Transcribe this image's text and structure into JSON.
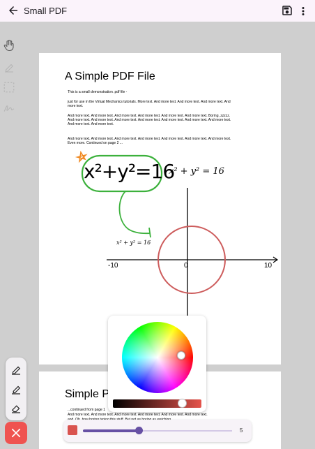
{
  "appbar": {
    "title": "Small PDF"
  },
  "colors": {
    "ink_green": "#3cb13c",
    "ink_orange": "#f08a24",
    "circle_red": "#cd5c5c",
    "accent": "#6750a4",
    "close": "#ef5350",
    "selected_color": "#d9534f"
  },
  "icons": {
    "back": "back-arrow-icon",
    "save": "save-icon",
    "more": "more-vert-icon",
    "hand": "hand-icon",
    "pen": "pen-icon",
    "select": "select-icon",
    "signature": "signature-icon",
    "eraser": "eraser-icon",
    "close": "close-icon"
  },
  "page1": {
    "title": "A Simple PDF File",
    "p1": "This is a small demonstration .pdf file -",
    "p2": "just for use in the Virtual Mechanics tutorials. More text. And more text. And more text. And more text. And more text.",
    "p3": "And more text. And more text. And more text. And more text. And more text. And more text. Boring, zzzzz. And more text. And more text. And more text. And more text. And more text. And more text. And more text. And more text. And more text.",
    "p4": "And more text. And more text. And more text. And more text. And more text. And more text. And more text. Even more. Continued on page 2 ...",
    "handwriting": "x²+y²=16",
    "equation": "x² + y² = 16",
    "small_equation": "x² + y² = 16",
    "axis": {
      "left": "-10",
      "origin": "0",
      "right": "10"
    }
  },
  "page2": {
    "title": "Simple P",
    "text1": "...continued from page 1",
    "text2": "And more text. And more text. And more text. And more text. And more text. And more text.",
    "text3": "and. Oh, how boring typing this stuff. But not as boring as watching"
  },
  "toolbar": {
    "brush_size": "5",
    "brush_size_fraction": 0.35
  }
}
